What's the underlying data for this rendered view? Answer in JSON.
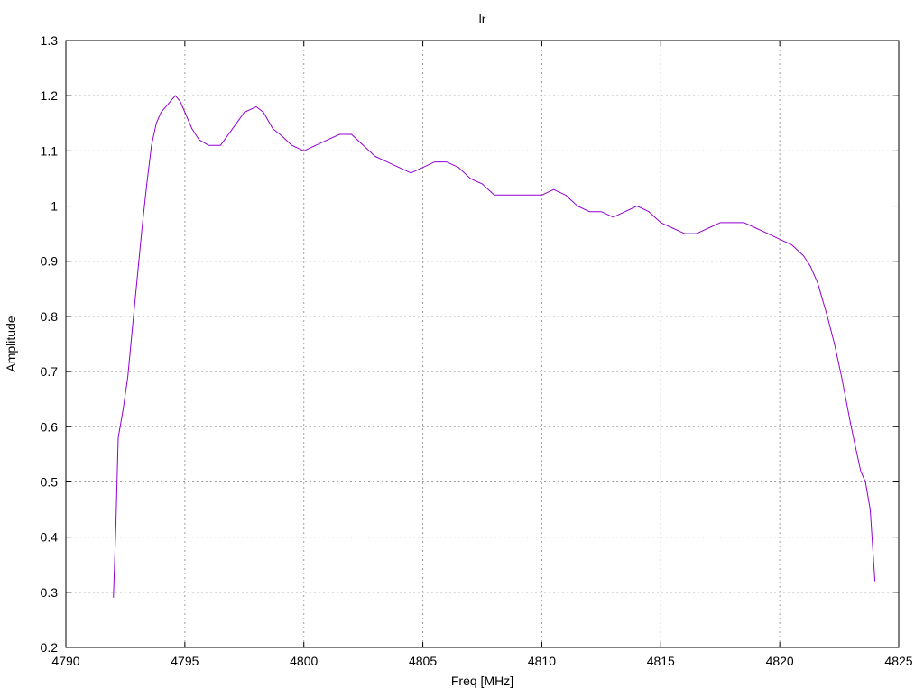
{
  "chart_data": {
    "type": "line",
    "title": "lr",
    "xlabel": "Freq [MHz]",
    "ylabel": "Amplitude",
    "xlim": [
      4790,
      4825
    ],
    "ylim": [
      0.2,
      1.3
    ],
    "grid": true,
    "x_ticks": [
      4790,
      4795,
      4800,
      4805,
      4810,
      4815,
      4820,
      4825
    ],
    "y_ticks": [
      0.2,
      0.3,
      0.4,
      0.5,
      0.6,
      0.7,
      0.8,
      0.9,
      1,
      1.1,
      1.2,
      1.3
    ],
    "x_tick_labels": [
      "4790",
      "4795",
      "4800",
      "4805",
      "4810",
      "4815",
      "4820",
      "4825"
    ],
    "y_tick_labels": [
      "0.2",
      "0.3",
      "0.4",
      "0.5",
      "0.6",
      "0.7",
      "0.8",
      "0.9",
      "1",
      "1.1",
      "1.2",
      "1.3"
    ],
    "series": [
      {
        "color": "#9400d3",
        "x": [
          4792.0,
          4792.1,
          4792.2,
          4792.4,
          4792.6,
          4792.8,
          4793.0,
          4793.2,
          4793.4,
          4793.6,
          4793.8,
          4794.0,
          4794.2,
          4794.4,
          4794.6,
          4794.8,
          4795.0,
          4795.3,
          4795.6,
          4796.0,
          4796.5,
          4797.0,
          4797.5,
          4798.0,
          4798.3,
          4798.7,
          4799.0,
          4799.5,
          4800.0,
          4800.5,
          4801.0,
          4801.5,
          4802.0,
          4802.5,
          4803.0,
          4803.5,
          4804.0,
          4804.5,
          4805.0,
          4805.5,
          4806.0,
          4806.5,
          4807.0,
          4807.5,
          4808.0,
          4808.5,
          4809.0,
          4809.5,
          4810.0,
          4810.5,
          4811.0,
          4811.5,
          4812.0,
          4812.5,
          4813.0,
          4813.5,
          4814.0,
          4814.5,
          4815.0,
          4815.5,
          4816.0,
          4816.5,
          4817.0,
          4817.5,
          4818.0,
          4818.5,
          4819.0,
          4819.5,
          4820.0,
          4820.5,
          4821.0,
          4821.3,
          4821.6,
          4822.0,
          4822.3,
          4822.6,
          4823.0,
          4823.2,
          4823.4,
          4823.6,
          4823.8,
          4824.0
        ],
        "y": [
          0.29,
          0.42,
          0.58,
          0.63,
          0.69,
          0.78,
          0.87,
          0.96,
          1.04,
          1.11,
          1.15,
          1.17,
          1.18,
          1.19,
          1.2,
          1.19,
          1.17,
          1.14,
          1.12,
          1.11,
          1.11,
          1.14,
          1.17,
          1.18,
          1.17,
          1.14,
          1.13,
          1.11,
          1.1,
          1.11,
          1.12,
          1.13,
          1.13,
          1.11,
          1.09,
          1.08,
          1.07,
          1.06,
          1.07,
          1.08,
          1.08,
          1.07,
          1.05,
          1.04,
          1.02,
          1.02,
          1.02,
          1.02,
          1.02,
          1.03,
          1.02,
          1.0,
          0.99,
          0.99,
          0.98,
          0.99,
          1.0,
          0.99,
          0.97,
          0.96,
          0.95,
          0.95,
          0.96,
          0.97,
          0.97,
          0.97,
          0.96,
          0.95,
          0.94,
          0.93,
          0.91,
          0.89,
          0.86,
          0.8,
          0.75,
          0.69,
          0.6,
          0.56,
          0.52,
          0.5,
          0.45,
          0.32
        ]
      }
    ]
  }
}
